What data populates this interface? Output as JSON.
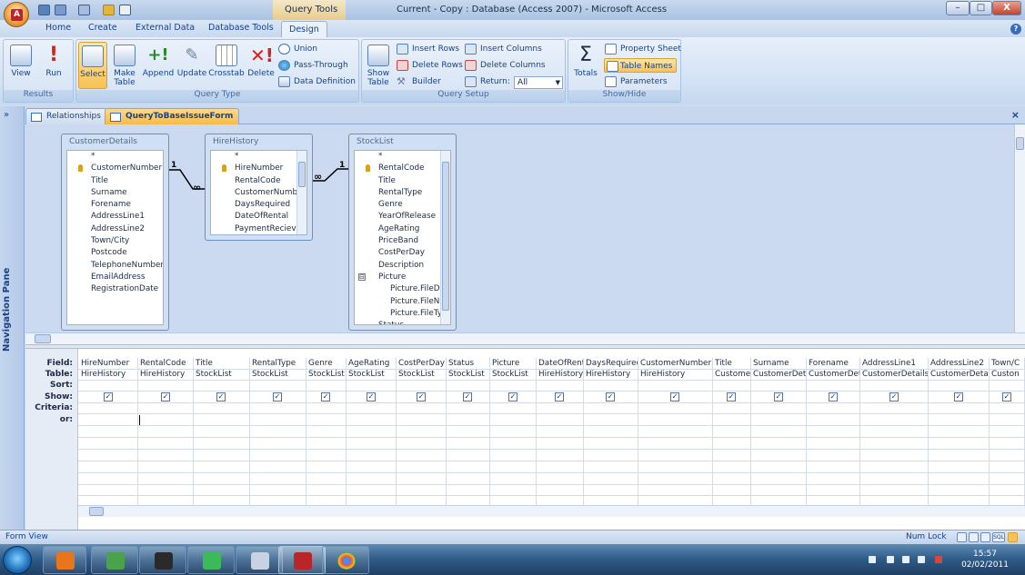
{
  "window": {
    "context_label": "Query Tools",
    "title": "Current - Copy : Database (Access 2007) - Microsoft Access",
    "buttons": [
      "–",
      "□",
      "X"
    ]
  },
  "ribbon_tabs": [
    "Home",
    "Create",
    "External Data",
    "Database Tools",
    "Design"
  ],
  "ribbon": {
    "results": {
      "label": "Results",
      "view": "View",
      "run": "Run"
    },
    "query_type": {
      "label": "Query Type",
      "select": "Select",
      "make_table": [
        "Make",
        "Table"
      ],
      "append": "Append",
      "update": "Update",
      "crosstab": "Crosstab",
      "delete": "Delete",
      "union": "Union",
      "pass_through": "Pass-Through",
      "data_definition": "Data Definition"
    },
    "query_setup": {
      "label": "Query Setup",
      "show_table": [
        "Show",
        "Table"
      ],
      "insert_rows": "Insert Rows",
      "delete_rows": "Delete Rows",
      "builder": "Builder",
      "insert_columns": "Insert Columns",
      "delete_columns": "Delete Columns",
      "return_label": "Return:",
      "return_value": "All"
    },
    "show_hide": {
      "label": "Show/Hide",
      "totals": "Totals",
      "property_sheet": "Property Sheet",
      "table_names": "Table Names",
      "parameters": "Parameters"
    }
  },
  "nav_pane": {
    "label": "Navigation Pane",
    "chevron": "»"
  },
  "doc_tabs": [
    {
      "label": "Relationships",
      "active": false
    },
    {
      "label": "QueryToBaseIssueForm",
      "active": true
    }
  ],
  "doc_close": "×",
  "tables": [
    {
      "name": "CustomerDetails",
      "fields": [
        {
          "name": "*",
          "pk": false
        },
        {
          "name": "CustomerNumber",
          "pk": true
        },
        {
          "name": "Title",
          "pk": false
        },
        {
          "name": "Surname",
          "pk": false
        },
        {
          "name": "Forename",
          "pk": false
        },
        {
          "name": "AddressLine1",
          "pk": false
        },
        {
          "name": "AddressLine2",
          "pk": false
        },
        {
          "name": "Town/City",
          "pk": false
        },
        {
          "name": "Postcode",
          "pk": false
        },
        {
          "name": "TelephoneNumber",
          "pk": false
        },
        {
          "name": "EmailAddress",
          "pk": false
        },
        {
          "name": "RegistrationDate",
          "pk": false
        }
      ]
    },
    {
      "name": "HireHistory",
      "fields": [
        {
          "name": "*",
          "pk": false
        },
        {
          "name": "HireNumber",
          "pk": true
        },
        {
          "name": "RentalCode",
          "pk": false
        },
        {
          "name": "CustomerNumb",
          "pk": false
        },
        {
          "name": "DaysRequired",
          "pk": false
        },
        {
          "name": "DateOfRental",
          "pk": false
        },
        {
          "name": "PaymentRecieve",
          "pk": false
        }
      ]
    },
    {
      "name": "StockList",
      "fields": [
        {
          "name": "*",
          "pk": false
        },
        {
          "name": "RentalCode",
          "pk": true
        },
        {
          "name": "Title",
          "pk": false
        },
        {
          "name": "RentalType",
          "pk": false
        },
        {
          "name": "Genre",
          "pk": false
        },
        {
          "name": "YearOfRelease",
          "pk": false
        },
        {
          "name": "AgeRating",
          "pk": false
        },
        {
          "name": "PriceBand",
          "pk": false
        },
        {
          "name": "CostPerDay",
          "pk": false
        },
        {
          "name": "Description",
          "pk": false
        },
        {
          "name": "Picture",
          "pk": false,
          "expand": "⊟"
        },
        {
          "name": "Picture.FileD",
          "pk": false,
          "sub": true
        },
        {
          "name": "Picture.FileN",
          "pk": false,
          "sub": true
        },
        {
          "name": "Picture.FileTy",
          "pk": false,
          "sub": true
        },
        {
          "name": "Status",
          "pk": false
        }
      ]
    }
  ],
  "relationships": [
    {
      "one": "1",
      "many": "∞"
    },
    {
      "one": "1",
      "many": "∞"
    }
  ],
  "grid": {
    "row_labels": [
      "Field:",
      "Table:",
      "Sort:",
      "Show:",
      "Criteria:",
      "or:"
    ],
    "columns": [
      {
        "field": "HireNumber",
        "table": "HireHistory"
      },
      {
        "field": "RentalCode",
        "table": "HireHistory"
      },
      {
        "field": "Title",
        "table": "StockList"
      },
      {
        "field": "RentalType",
        "table": "StockList"
      },
      {
        "field": "Genre",
        "table": "StockList"
      },
      {
        "field": "AgeRating",
        "table": "StockList"
      },
      {
        "field": "CostPerDay",
        "table": "StockList"
      },
      {
        "field": "Status",
        "table": "StockList"
      },
      {
        "field": "Picture",
        "table": "StockList"
      },
      {
        "field": "DateOfRent",
        "table": "HireHistory"
      },
      {
        "field": "DaysRequirec",
        "table": "HireHistory"
      },
      {
        "field": "CustomerNumber",
        "table": "HireHistory"
      },
      {
        "field": "Title",
        "table": "Customer"
      },
      {
        "field": "Surname",
        "table": "CustomerDet"
      },
      {
        "field": "Forename",
        "table": "CustomerDet"
      },
      {
        "field": "AddressLine1",
        "table": "CustomerDetails"
      },
      {
        "field": "AddressLine2",
        "table": "CustomerDetai"
      },
      {
        "field": "Town/C",
        "table": "Custon"
      }
    ],
    "check_mark": "✓"
  },
  "status": {
    "left": "Form View",
    "num_lock": "Num Lock",
    "sql": "SQL"
  },
  "taskbar": {
    "time": "15:57",
    "date": "02/02/2011"
  }
}
